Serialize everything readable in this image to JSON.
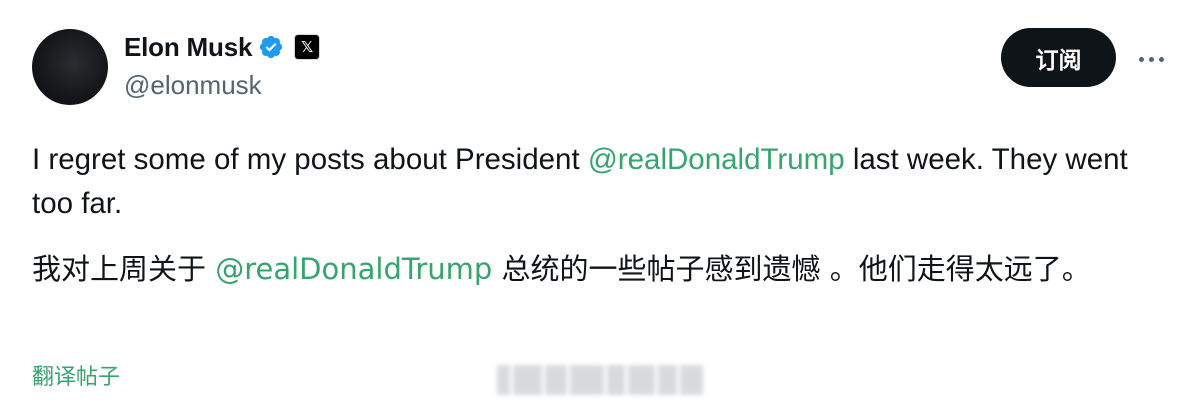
{
  "author": {
    "display_name": "Elon Musk",
    "handle": "@elonmusk",
    "verified_icon": "verified-badge-icon",
    "affiliate_icon": "x-logo-icon",
    "affiliate_glyph": "𝕏"
  },
  "actions": {
    "subscribe_label": "订阅",
    "more_icon": "more-horizontal-icon"
  },
  "tweet": {
    "en_before": "I regret some of my posts about President ",
    "en_mention": "@realDonaldTrump",
    "en_after": " last week. They went too far.",
    "zh_before": "我对上周关于 ",
    "zh_mention": "@realDonaldTrump",
    "zh_after": " 总统的一些帖子感到遗憾 。他们走得太远了。"
  },
  "translate_label": "翻译帖子",
  "colors": {
    "mention": "#36a46e",
    "verified": "#1d9bf0",
    "text": "#0f1419",
    "secondary": "#536471"
  }
}
